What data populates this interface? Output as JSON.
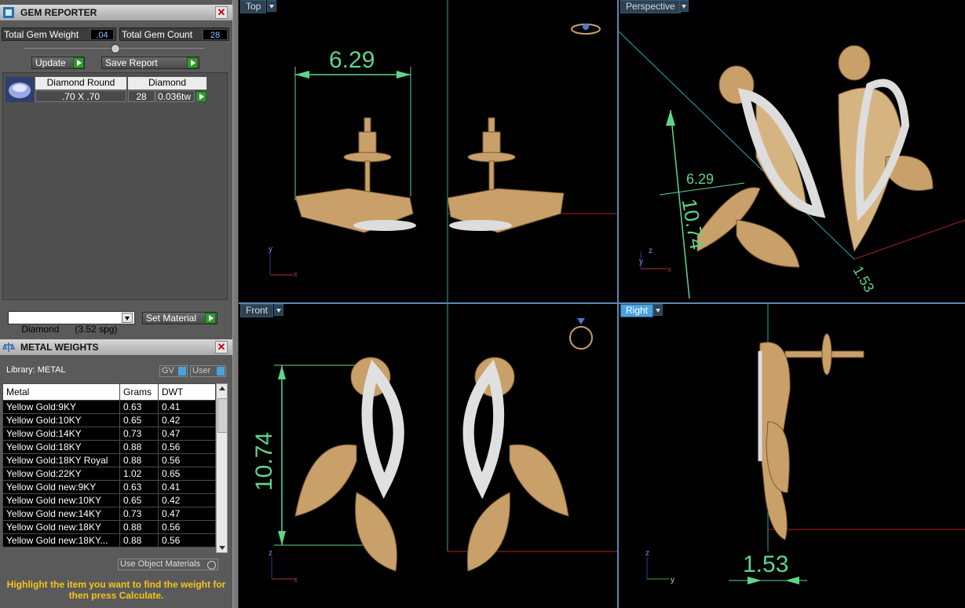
{
  "gem_reporter": {
    "title": "GEM REPORTER",
    "total_weight_label": "Total Gem Weight",
    "total_weight_value": ".04",
    "total_count_label": "Total Gem Count",
    "total_count_value": "28",
    "update_label": "Update",
    "save_report_label": "Save Report",
    "gem_row": {
      "shape": "Diamond Round",
      "size": ".70 X .70",
      "material": "Diamond",
      "count": "28",
      "weight": "0.036tw"
    },
    "material_select": "Diamond      (3.52 spg)",
    "set_material_label": "Set Material"
  },
  "metal_weights": {
    "title": "METAL WEIGHTS",
    "library_label": "Library: METAL",
    "gv_label": "GV",
    "user_label": "User",
    "columns": [
      "Metal",
      "Grams",
      "DWT"
    ],
    "rows": [
      [
        "Yellow Gold:9KY",
        "0.63",
        "0.41"
      ],
      [
        "Yellow Gold:10KY",
        "0.65",
        "0.42"
      ],
      [
        "Yellow Gold:14KY",
        "0.73",
        "0.47"
      ],
      [
        "Yellow Gold:18KY",
        "0.88",
        "0.56"
      ],
      [
        "Yellow Gold:18KY Royal",
        "0.88",
        "0.56"
      ],
      [
        "Yellow Gold:22KY",
        "1.02",
        "0.65"
      ],
      [
        "Yellow Gold new:9KY",
        "0.63",
        "0.41"
      ],
      [
        "Yellow Gold new:10KY",
        "0.65",
        "0.42"
      ],
      [
        "Yellow Gold new:14KY",
        "0.73",
        "0.47"
      ],
      [
        "Yellow Gold new:18KY",
        "0.88",
        "0.56"
      ],
      [
        "Yellow Gold new:18KY...",
        "0.88",
        "0.56"
      ]
    ],
    "use_object_materials": "Use Object Materials",
    "hint": "Highlight the item you want to find the weight for then press Calculate."
  },
  "viewports": {
    "top": {
      "label": "Top",
      "dim": "6.29"
    },
    "perspective": {
      "label": "Perspective",
      "dim1": "6.29",
      "dim2": "10.74",
      "dim3": "1.53"
    },
    "front": {
      "label": "Front",
      "dim": "10.74"
    },
    "right": {
      "label": "Right",
      "dim": "1.53"
    }
  },
  "axes": {
    "x": "x",
    "y": "y",
    "z": "z"
  },
  "colors": {
    "accent": "#4aa3df",
    "dimension": "#5fd58a",
    "gold": "#c9a06a",
    "hint": "#f5c518"
  }
}
